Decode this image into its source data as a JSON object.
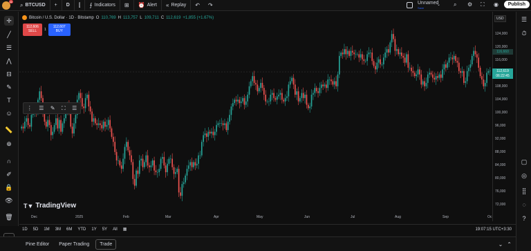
{
  "topbar": {
    "avatar_badge": "11",
    "symbol": "BTCUSD",
    "add_symbol": "+",
    "interval": "D",
    "indicators_label": "Indicators",
    "alert_label": "Alert",
    "replay_label": "Replay",
    "layout_name": "Unnamed",
    "layout_sub": "Save",
    "publish_label": "Publish"
  },
  "legend": {
    "title": "Bitcoin / U.S. Dollar · 1D · Bitstamp",
    "o_label": "O",
    "o_value": "110,769",
    "h_label": "H",
    "h_value": "113,757",
    "l_label": "L",
    "l_value": "109,711",
    "c_label": "C",
    "c_value": "112,619",
    "change": "+1,855 (+1.67%)"
  },
  "trade": {
    "sell_price": "112,606",
    "sell_label": "SELL",
    "spread": "1",
    "buy_price": "112,607",
    "buy_label": "BUY"
  },
  "price_axis": {
    "currency": "USD",
    "labels": [
      "124,000",
      "120,000",
      "116,000",
      "112,000",
      "108,000",
      "104,000",
      "100,000",
      "96,000",
      "92,000",
      "88,000",
      "84,000",
      "80,000",
      "76,000",
      "72,000"
    ],
    "ghost_price": "116,660",
    "last_price": "112,619",
    "countdown": "06:22:45"
  },
  "time_axis": {
    "labels": [
      "Dec",
      "2025",
      "Feb",
      "Mar",
      "Apr",
      "May",
      "Jun",
      "Jul",
      "Aug",
      "Sep",
      "Oc"
    ]
  },
  "watermark": "TradingView",
  "ranges": [
    "1D",
    "5D",
    "1M",
    "3M",
    "6M",
    "YTD",
    "1Y",
    "5Y",
    "All"
  ],
  "clock": "19:07:15 UTC+3:30",
  "bottom_tabs": [
    "Pine Editor",
    "Paper Trading",
    "Trade"
  ],
  "chart_data": {
    "type": "candlestick",
    "title": "Bitcoin / U.S. Dollar · 1D · Bitstamp",
    "ylim": [
      70000,
      126000
    ],
    "y_ticks": [
      124000,
      120000,
      116000,
      112000,
      108000,
      104000,
      100000,
      96000,
      92000,
      88000,
      84000,
      80000,
      76000,
      72000
    ],
    "x_ticks": [
      "Dec",
      "2025",
      "Feb",
      "Mar",
      "Apr",
      "May",
      "Jun",
      "Jul",
      "Aug",
      "Sep",
      "Oc"
    ],
    "series": [
      {
        "close": [
          96000,
          95500,
          97500,
          98500,
          96500,
          96000,
          99500,
          100500,
          101500,
          100000,
          104000,
          106500,
          104500,
          100500,
          97500,
          96000,
          98000,
          96500,
          93500,
          94500,
          96500,
          98500,
          95500,
          98000,
          94500,
          97000,
          98500,
          101000,
          102500,
          100500,
          96000,
          94000,
          97000,
          99500,
          104000,
          106000,
          104500,
          102000,
          101500,
          104500,
          105500,
          102000,
          100500,
          97500,
          98500,
          97000,
          96500,
          97000,
          96500,
          95500,
          97500,
          96000,
          96500,
          98000,
          95500,
          93000,
          91500,
          88500,
          86000,
          86000,
          84500,
          83500,
          86500,
          90000,
          91500,
          89000,
          87500,
          85500,
          80500,
          78500,
          83000,
          82000,
          86000,
          86500,
          84000,
          85500,
          87500,
          84500,
          84000,
          84500,
          86000,
          83000,
          82500,
          82500,
          83500,
          86500,
          87000,
          84500,
          82500,
          85000,
          86500,
          86500,
          84000,
          82000,
          82500,
          83500,
          76500,
          75500,
          79000,
          79500,
          81500,
          83500,
          84500,
          85500,
          84000,
          85500,
          84500,
          85000,
          87500,
          87500,
          91500,
          93500,
          94000,
          93000,
          94500,
          94000,
          94500,
          93500,
          94500,
          96500,
          97000,
          97000,
          97000,
          96500,
          97000,
          95000,
          97500,
          99500,
          102000,
          103000,
          104000,
          103500,
          104000,
          103000,
          103500,
          104500,
          102500,
          103500,
          105500,
          108000,
          109500,
          111000,
          109000,
          108500,
          106500,
          107500,
          109000,
          107500,
          105500,
          103500,
          103500,
          103500,
          105500,
          106000,
          104500,
          104000,
          105000,
          105500,
          106000,
          104000,
          103500,
          104500,
          105000,
          108500,
          109500,
          110500,
          108500,
          105500,
          106500,
          103500,
          104500,
          106000,
          104500,
          105500,
          102500,
          101500,
          102000,
          105500,
          106000,
          107500,
          106500,
          106000,
          107500,
          108500,
          108000,
          108500,
          107500,
          110000,
          110000,
          109500,
          108500,
          109500,
          108000,
          111500,
          117000,
          118000,
          117500,
          119000,
          117500,
          118500,
          117000,
          118500,
          118000,
          117500,
          117500,
          117500,
          116500,
          117500,
          116000,
          115500,
          115500,
          117500,
          118000,
          118000,
          115500,
          114000,
          113000,
          115000,
          116000,
          114500,
          114500,
          116500,
          118000,
          119000,
          118000,
          121000,
          123500,
          122000,
          118500,
          119000,
          117500,
          118000,
          117000,
          116500,
          115000,
          117500,
          113500,
          113500,
          112500,
          112000,
          111000,
          111500,
          113000,
          111500,
          108500,
          109500,
          108000,
          109000,
          111500,
          112000,
          111500,
          110500,
          110000,
          111000,
          110500,
          111500,
          110500,
          113000,
          114500,
          113500,
          115000,
          116500,
          116500,
          116000,
          117000,
          115500,
          115000,
          112500,
          112000,
          112500,
          109000,
          109500,
          112500,
          113500,
          114500,
          117000,
          118500,
          117500,
          116500,
          113500,
          111000,
          110000,
          108000,
          109000,
          112000,
          112500,
          112600
        ]
      }
    ]
  }
}
